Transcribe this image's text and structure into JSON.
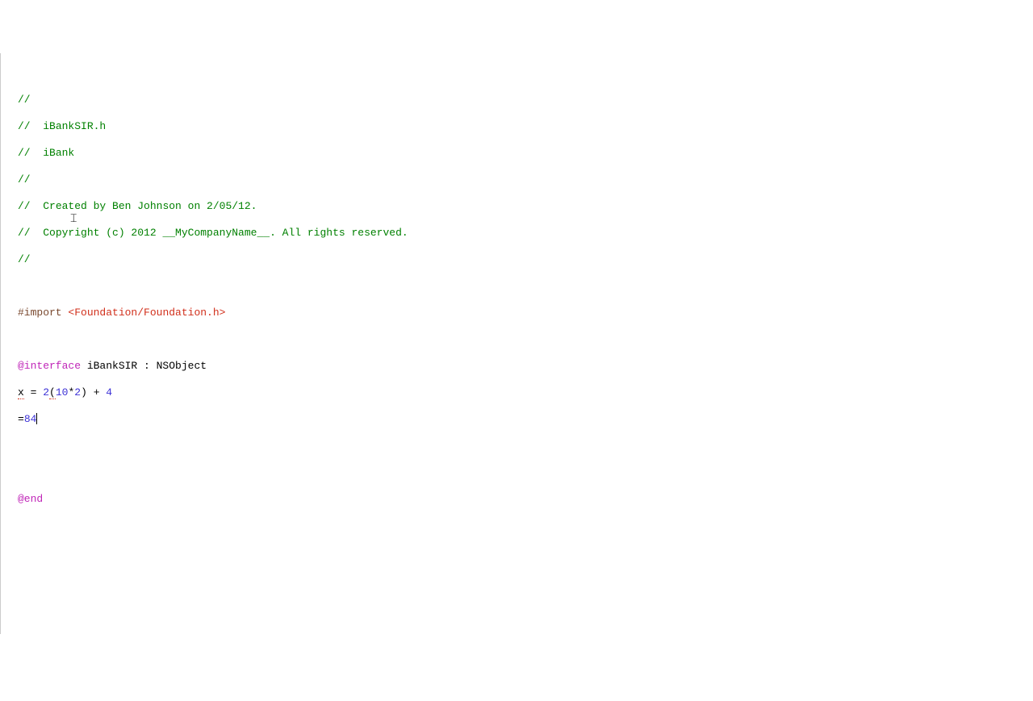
{
  "code": {
    "line1": "//",
    "line2_prefix": "//  ",
    "line2_text": "iBankSIR.h",
    "line3_prefix": "//  ",
    "line3_text": "iBank",
    "line4": "//",
    "line5_prefix": "//  ",
    "line5_text": "Created by Ben Johnson on 2/05/12.",
    "line6_prefix": "//  ",
    "line6_text": "Copyright (c) 2012 __MyCompanyName__. All rights reserved.",
    "line7": "//",
    "import_directive": "#import ",
    "import_path": "<Foundation/Foundation.h>",
    "interface_keyword": "@interface",
    "interface_rest": " iBankSIR : NSObject",
    "expr_x": "x",
    "expr_eq": " = ",
    "expr_num2": "2",
    "expr_paren_open": "(",
    "expr_num10": "10",
    "expr_star": "*",
    "expr_num2b": "2",
    "expr_paren_close": ")",
    "expr_plus": " + ",
    "expr_num4": "4",
    "result_eq": "=",
    "result_val": "84",
    "end_keyword": "@end"
  }
}
